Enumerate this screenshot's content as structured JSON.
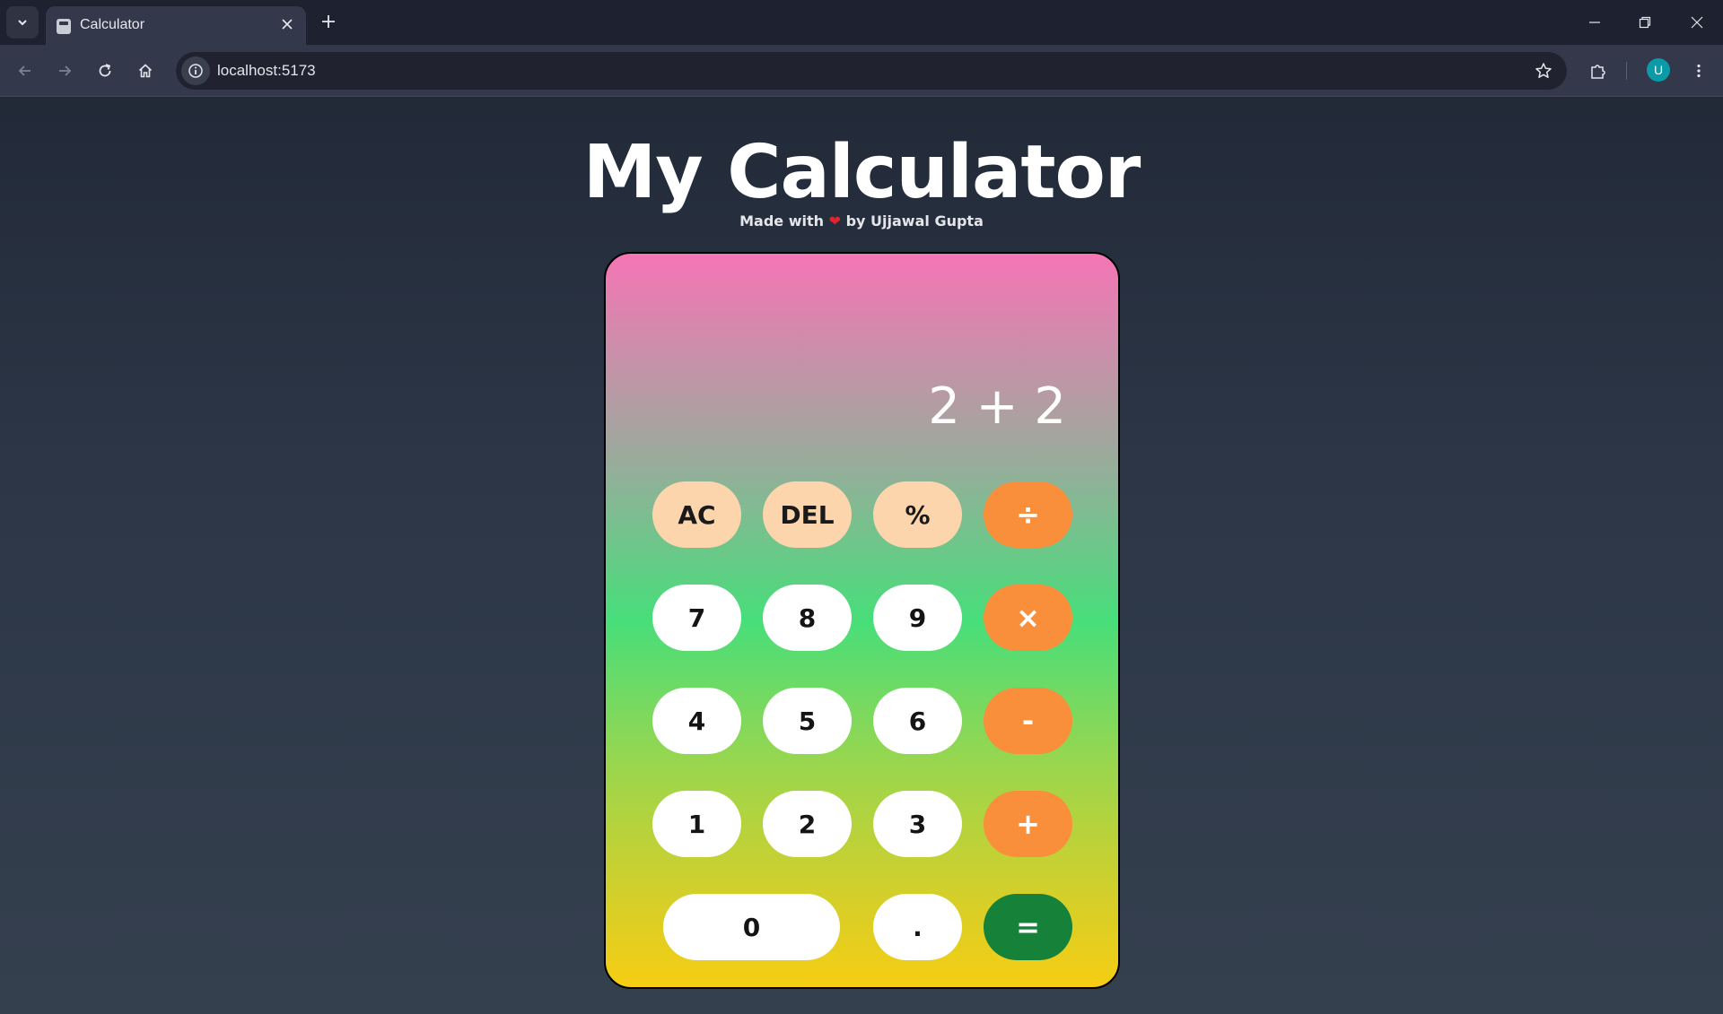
{
  "browser": {
    "tab_title": "Calculator",
    "url": "localhost:5173",
    "avatar_letter": "U"
  },
  "page": {
    "title": "My Calculator",
    "subtitle_prefix": "Made with",
    "subtitle_heart": "❤",
    "subtitle_suffix": "by Ujjawal Gupta"
  },
  "calculator": {
    "display": "2 + 2",
    "keys": {
      "ac": "AC",
      "del": "DEL",
      "percent": "%",
      "divide": "÷",
      "seven": "7",
      "eight": "8",
      "nine": "9",
      "multiply": "×",
      "four": "4",
      "five": "5",
      "six": "6",
      "minus": "-",
      "one": "1",
      "two": "2",
      "three": "3",
      "plus": "+",
      "zero": "0",
      "dot": ".",
      "equals": "="
    }
  },
  "colors": {
    "function_key": "#fdd5ad",
    "operator_key": "#f98f3b",
    "equals_key": "#168139",
    "number_key": "#ffffff"
  }
}
